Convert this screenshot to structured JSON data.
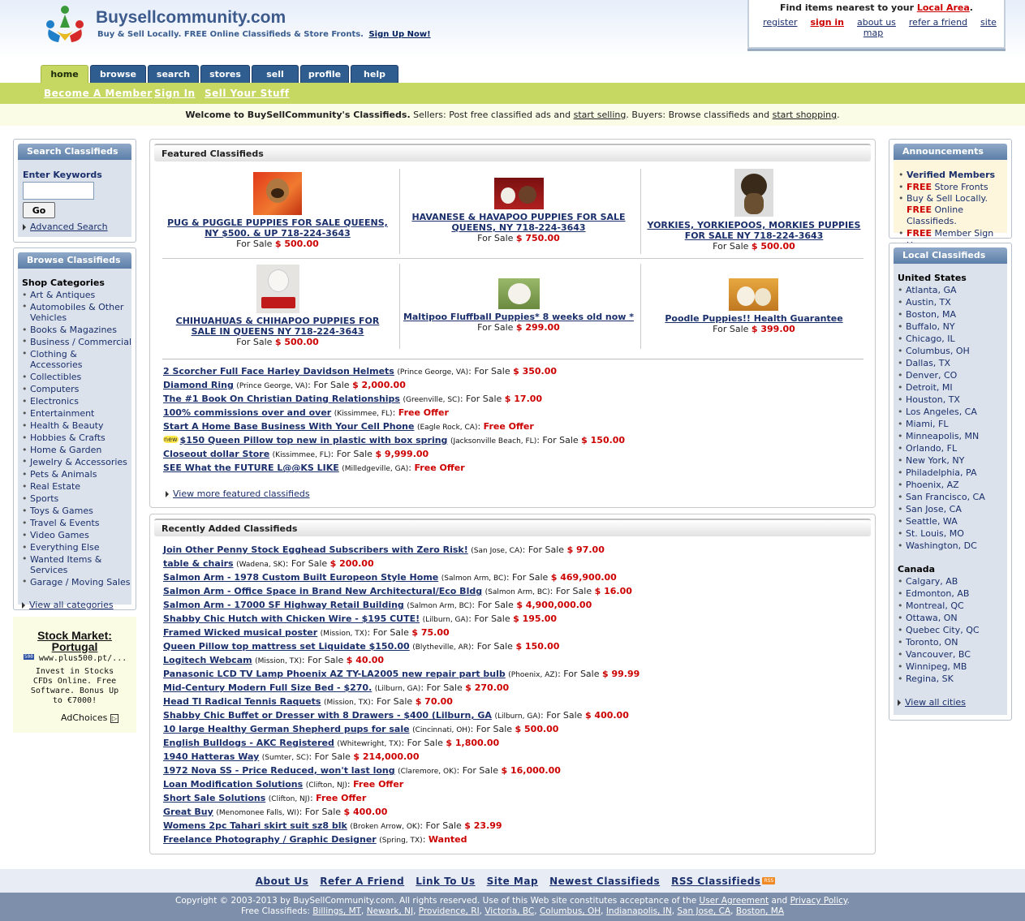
{
  "header": {
    "site_name": "Buysellcommunity.com",
    "tagline": "Buy & Sell Locally. FREE Online Classifieds & Store Fronts.",
    "signup": "Sign Up Now!"
  },
  "local_box": {
    "title_prefix": "Find items nearest to your",
    "title_link": "Local Area",
    "title_suffix": ".",
    "links": [
      "register",
      "sign in",
      "about us",
      "refer a friend",
      "site map"
    ]
  },
  "tabs": [
    "home",
    "browse",
    "search",
    "stores",
    "sell",
    "profile",
    "help"
  ],
  "subnav": [
    "Become A Member",
    "Sign In",
    "Sell Your Stuff"
  ],
  "welcome": {
    "bold": "Welcome to BuySellCommunity's Classifieds.",
    "t1": " Sellers: Post free classified ads and ",
    "l1": "start selling",
    "t2": ". Buyers: Browse classifieds and ",
    "l2": "start shopping",
    "t3": "."
  },
  "search_panel": {
    "title": "Search Classifieds",
    "label": "Enter Keywords",
    "input_value": "",
    "go": "Go",
    "advanced": "Advanced Search"
  },
  "browse_panel": {
    "title": "Browse Classifieds",
    "heading": "Shop Categories",
    "categories": [
      "Art & Antiques",
      "Automobiles & Other Vehicles",
      "Books & Magazines",
      "Business / Commercial",
      "Clothing & Accessories",
      "Collectibles",
      "Computers",
      "Electronics",
      "Entertainment",
      "Health & Beauty",
      "Hobbies & Crafts",
      "Home & Garden",
      "Jewelry & Accessories",
      "Pets & Animals",
      "Real Estate",
      "Sports",
      "Toys & Games",
      "Travel & Events",
      "Video Games",
      "Everything Else",
      "Wanted Items & Services",
      "Garage / Moving Sales"
    ],
    "view_all": "View all categories"
  },
  "ad": {
    "title": "Stock Market: Portugal",
    "url": "www.plus500.pt/...",
    "badge": "500",
    "body": "Invest in Stocks CFDs Online. Free Software. Bonus Up to €7000!",
    "adchoices": "AdChoices"
  },
  "featured": {
    "title": "Featured Classifieds",
    "for_sale": "For Sale",
    "items": [
      {
        "title": "PUG & PUGGLE PUPPIES FOR SALE QUEENS, NY $500. & UP 718-224-3643",
        "price": "$ 500.00"
      },
      {
        "title": "HAVANESE & HAVAPOO PUPPIES FOR SALE QUEENS, NY 718-224-3643",
        "price": "$ 750.00"
      },
      {
        "title": "YORKIES, YORKIEPOOS, MORKIES PUPPIES FOR SALE NY 718-224-3643",
        "price": "$ 500.00"
      },
      {
        "title": "CHIHUAHUAS & CHIHAPOO PUPPIES FOR SALE IN QUEENS NY 718-224-3643",
        "price": "$ 500.00"
      },
      {
        "title": "Maltipoo Fluffball Puppies* 8 weeks old now *",
        "price": "$ 299.00"
      },
      {
        "title": "Poodle Puppies!! Health Guarantee",
        "price": "$ 399.00"
      }
    ],
    "list": [
      {
        "title": "2 Scorcher Full Face Harley Davidson Helmets",
        "loc": "(Prince George, VA)",
        "label": ": For Sale",
        "price": "$ 350.00"
      },
      {
        "title": "Diamond Ring",
        "loc": "(Prince George, VA)",
        "label": ": For Sale",
        "price": "$ 2,000.00"
      },
      {
        "title": "The #1 Book On Christian Dating Relationships",
        "loc": "(Greenville, SC)",
        "label": ": For Sale",
        "price": "$ 17.00"
      },
      {
        "title": "100% commissions over and over",
        "loc": "(Kissimmee, FL)",
        "label": ":",
        "price": "Free Offer"
      },
      {
        "title": "Start A Home Base Business With Your Cell Phone",
        "loc": "(Eagle Rock, CA)",
        "label": ":",
        "price": "Free Offer"
      },
      {
        "title": "$150 Queen Pillow top new in plastic with box spring",
        "loc": "(Jacksonville Beach, FL)",
        "label": ": For Sale",
        "price": "$ 150.00",
        "new": "new"
      },
      {
        "title": "Closeout dollar Store",
        "loc": "(Kissimmee, FL)",
        "label": ": For Sale",
        "price": "$ 9,999.00"
      },
      {
        "title": "SEE What the FUTURE L@@KS LIKE",
        "loc": "(Milledgeville, GA)",
        "label": ":",
        "price": "Free Offer"
      }
    ],
    "view_more": "View more featured classifieds"
  },
  "recent": {
    "title": "Recently Added Classifieds",
    "list": [
      {
        "title": "Join Other Penny Stock Egghead Subscribers with Zero Risk!",
        "loc": "(San Jose, CA)",
        "label": ": For Sale",
        "price": "$ 97.00"
      },
      {
        "title": "table & chairs",
        "loc": "(Wadena, SK)",
        "label": ": For Sale",
        "price": "$ 200.00"
      },
      {
        "title": "Salmon Arm - 1978 Custom Built Europeon Style Home",
        "loc": "(Salmon Arm, BC)",
        "label": ": For Sale",
        "price": "$ 469,900.00"
      },
      {
        "title": "Salmon Arm - Office Space in Brand New Architectural/Eco Bldg",
        "loc": "(Salmon Arm, BC)",
        "label": ": For Sale",
        "price": "$ 16.00"
      },
      {
        "title": "Salmon Arm - 17000 SF Highway Retail Building",
        "loc": "(Salmon Arm, BC)",
        "label": ": For Sale",
        "price": "$ 4,900,000.00"
      },
      {
        "title": "Shabby Chic Hutch with Chicken Wire - $195 CUTE!",
        "loc": "(Lilburn, GA)",
        "label": ": For Sale",
        "price": "$ 195.00"
      },
      {
        "title": "Framed Wicked musical poster",
        "loc": "(Mission, TX)",
        "label": ": For Sale",
        "price": "$ 75.00"
      },
      {
        "title": "Queen Pillow top mattress set Liquidate $150.00",
        "loc": "(Blytheville, AR)",
        "label": ": For Sale",
        "price": "$ 150.00"
      },
      {
        "title": "Logitech Webcam",
        "loc": "(Mission, TX)",
        "label": ": For Sale",
        "price": "$ 40.00"
      },
      {
        "title": "Panasonic LCD TV Lamp Phoenix AZ TY-LA2005 new repair part bulb",
        "loc": "(Phoenix, AZ)",
        "label": ": For Sale",
        "price": "$ 99.99"
      },
      {
        "title": "Mid-Century Modern Full Size Bed - $270.",
        "loc": "(Lilburn, GA)",
        "label": ": For Sale",
        "price": "$ 270.00"
      },
      {
        "title": "Head TI Radical Tennis Raquets",
        "loc": "(Mission, TX)",
        "label": ": For Sale",
        "price": "$ 70.00"
      },
      {
        "title": "Shabby Chic Buffet or Dresser with 8 Drawers - $400 (Lilburn, GA",
        "loc": "(Lilburn, GA)",
        "label": ": For Sale",
        "price": "$ 400.00"
      },
      {
        "title": "10 large Healthy German Shepherd pups for sale",
        "loc": "(Cincinnati, OH)",
        "label": ": For Sale",
        "price": "$ 500.00"
      },
      {
        "title": "English Bulldogs - AKC Registered",
        "loc": "(Whitewright, TX)",
        "label": ": For Sale",
        "price": "$ 1,800.00"
      },
      {
        "title": "1940 Hatteras Way",
        "loc": "(Sumter, SC)",
        "label": ": For Sale",
        "price": "$ 214,000.00"
      },
      {
        "title": "1972 Nova SS - Price Reduced, won't last long",
        "loc": "(Claremore, OK)",
        "label": ": For Sale",
        "price": "$ 16,000.00"
      },
      {
        "title": "Loan Modification Solutions",
        "loc": "(Clifton, NJ)",
        "label": ":",
        "price": "Free Offer"
      },
      {
        "title": "Short Sale Solutions",
        "loc": "(Clifton, NJ)",
        "label": ":",
        "price": "Free Offer"
      },
      {
        "title": "Great Buy",
        "loc": "(Menomonee Falls, WI)",
        "label": ": For Sale",
        "price": "$ 400.00"
      },
      {
        "title": "Womens 2pc Tahari skirt suit sz8 blk",
        "loc": "(Broken Arrow, OK)",
        "label": ": For Sale",
        "price": "$ 23.99"
      },
      {
        "title": "Freelance Photography / Graphic Designer",
        "loc": "(Spring, TX)",
        "label": ":",
        "price": "Wanted"
      }
    ]
  },
  "announcements": {
    "title": "Announcements",
    "items": [
      {
        "red": "",
        "bold": "Verified Members",
        "text": ""
      },
      {
        "red": "FREE",
        "bold": "",
        "text": " Store Fronts"
      },
      {
        "red": "",
        "bold": "",
        "text": "Buy & Sell Locally. ",
        "red2": "FREE",
        "text2": " Online Classifieds."
      },
      {
        "red": "FREE",
        "bold": "",
        "text": " Member Sign Up"
      }
    ]
  },
  "local_classifieds": {
    "title": "Local Classifieds",
    "us_heading": "United States",
    "us": [
      "Atlanta, GA",
      "Austin, TX",
      "Boston, MA",
      "Buffalo, NY",
      "Chicago, IL",
      "Columbus, OH",
      "Dallas, TX",
      "Denver, CO",
      "Detroit, MI",
      "Houston, TX",
      "Los Angeles, CA",
      "Miami, FL",
      "Minneapolis, MN",
      "Orlando, FL",
      "New York, NY",
      "Philadelphia, PA",
      "Phoenix, AZ",
      "San Francisco, CA",
      "San Jose, CA",
      "Seattle, WA",
      "St. Louis, MO",
      "Washington, DC"
    ],
    "ca_heading": "Canada",
    "ca": [
      "Calgary, AB",
      "Edmonton, AB",
      "Montreal, QC",
      "Ottawa, ON",
      "Quebec City, QC",
      "Toronto, ON",
      "Vancouver, BC",
      "Winnipeg, MB",
      "Regina, SK"
    ],
    "view_all": "View all cities"
  },
  "footer": {
    "links": [
      "About Us",
      "Refer A Friend",
      "Link To Us",
      "Site Map",
      "Newest Classifieds",
      "RSS Classifieds"
    ],
    "rss_badge": "RSS",
    "copyright_pre": "Copyright © 2003-2013 by BuySellCommunity.com. All rights reserved. Use of this Web site constitutes acceptance of the ",
    "agreement": "User Agreement",
    "and": " and ",
    "privacy": "Privacy Policy",
    "dot": ".",
    "free_label": "Free Classifieds:",
    "cities": [
      "Billings, MT",
      "Newark, NJ",
      "Providence, RI",
      "Victoria, BC",
      "Columbus, OH",
      "Indianapolis, IN",
      "San Jose, CA",
      "Boston, MA"
    ]
  },
  "colors": {
    "nav_blue": "#2f5d8f",
    "lime": "#c6d862",
    "price_red": "#cc0000",
    "link_navy": "#1a2f6b"
  }
}
